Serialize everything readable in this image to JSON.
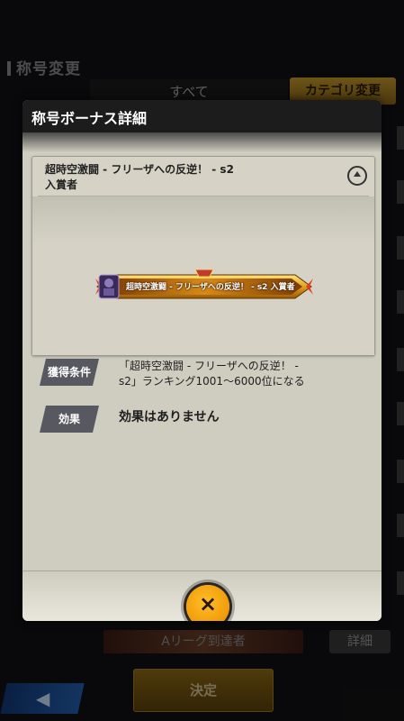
{
  "background": {
    "screen_title": "称号変更",
    "tab_all": "すべて",
    "category_button": "カテゴリ変更",
    "bottom_banner": "Aリーグ到達者",
    "detail_button": "詳細",
    "confirm_button": "決定",
    "back_icon": "arrow-left-icon"
  },
  "modal": {
    "title": "称号ボーナス詳細",
    "card": {
      "title_line1": "超時空激闘 - フリーザへの反逆！ - s2",
      "title_line2": "入賞者",
      "badge_label": "超時空激闘 - フリーザへの反逆！ - s2 入賞者",
      "rows": [
        {
          "tag": "獲得条件",
          "text_line1": "「超時空激闘 - フリーザへの反逆！ -",
          "text_line2": "s2」ランキング1001〜6000位になる"
        },
        {
          "tag": "効果",
          "text_line1": "効果はありません"
        }
      ]
    },
    "close_icon": "close-icon",
    "close_glyph": "×"
  },
  "colors": {
    "accent_gold": "#c79c2c",
    "close_orange": "#f09a06",
    "tag_gray": "#585860",
    "panel_beige": "#cfcdc0"
  }
}
